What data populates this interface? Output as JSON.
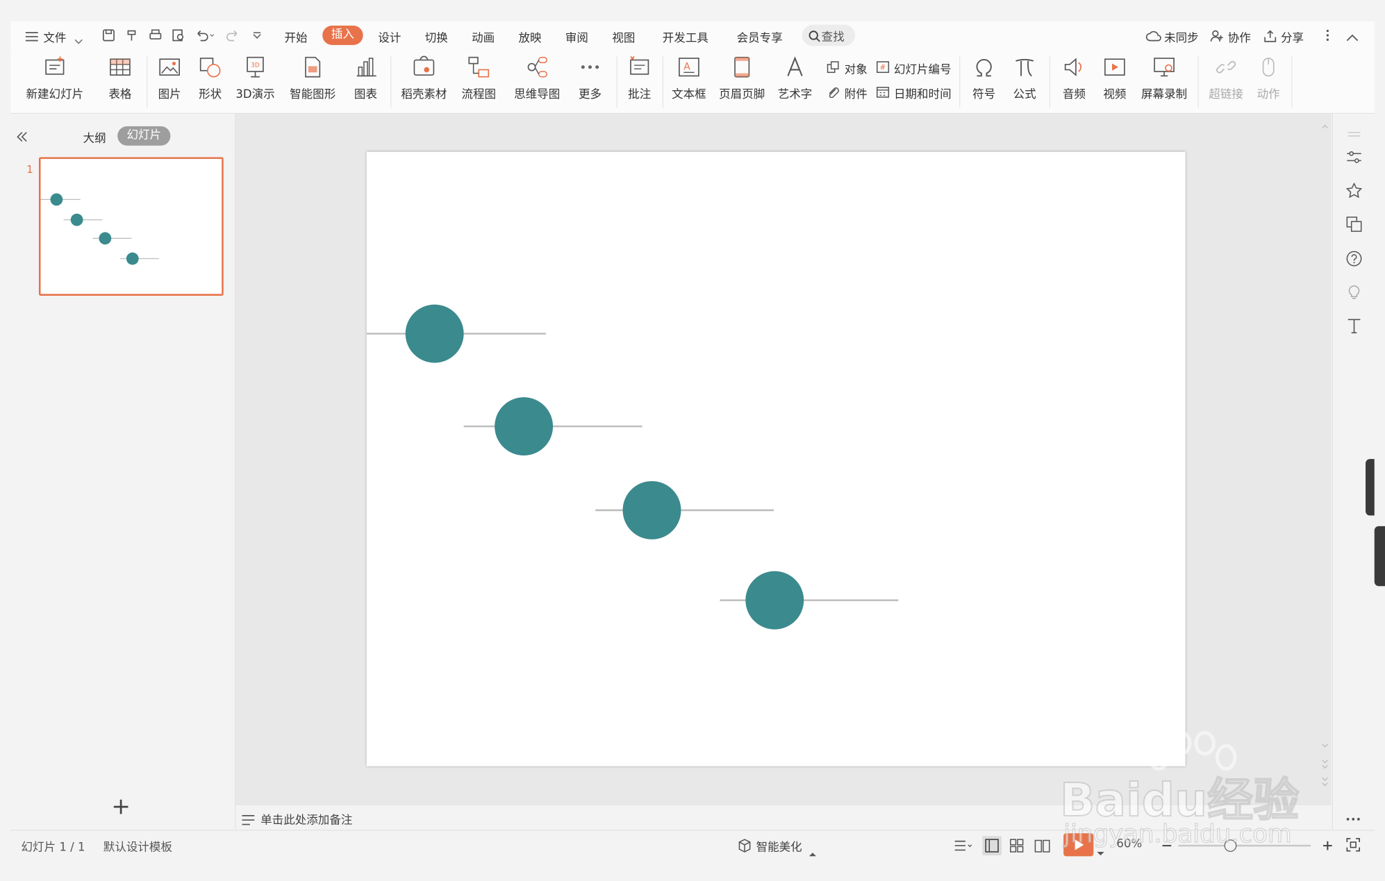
{
  "menubar": {
    "file": "文件",
    "tabs": [
      "开始",
      "插入",
      "设计",
      "切换",
      "动画",
      "放映",
      "审阅",
      "视图",
      "开发工具",
      "会员专享"
    ],
    "active_tab": "插入",
    "search": "查找",
    "sync": "未同步",
    "collab": "协作",
    "share": "分享"
  },
  "ribbon": {
    "new_slide": "新建幻灯片",
    "table": "表格",
    "picture": "图片",
    "shape": "形状",
    "demo3d": "3D演示",
    "smartart": "智能图形",
    "chart": "图表",
    "material": "稻壳素材",
    "flowchart": "流程图",
    "mindmap": "思维导图",
    "more": "更多",
    "comment": "批注",
    "textbox": "文本框",
    "header_footer": "页眉页脚",
    "wordart": "艺术字",
    "object": "对象",
    "slide_number": "幻灯片编号",
    "attachment": "附件",
    "datetime": "日期和时间",
    "symbol": "符号",
    "formula": "公式",
    "audio": "音频",
    "video": "视频",
    "screen_record": "屏幕录制",
    "hyperlink": "超链接",
    "action": "动作"
  },
  "leftpanel": {
    "outline_tab": "大纲",
    "slides_tab": "幻灯片",
    "slide_index": "1",
    "add_slide": "+"
  },
  "notes_placeholder": "单击此处添加备注",
  "status": {
    "slide_counter": "幻灯片 1 / 1",
    "template": "默认设计模板",
    "beautify": "智能美化",
    "zoom": "60%"
  },
  "colors": {
    "accent_orange": "#e8734a",
    "teal": "#3b8a8e",
    "line_gray": "#bdbdbd"
  },
  "watermark": {
    "brand": "Baidu经验",
    "url": "jingyan.baidu.com"
  }
}
